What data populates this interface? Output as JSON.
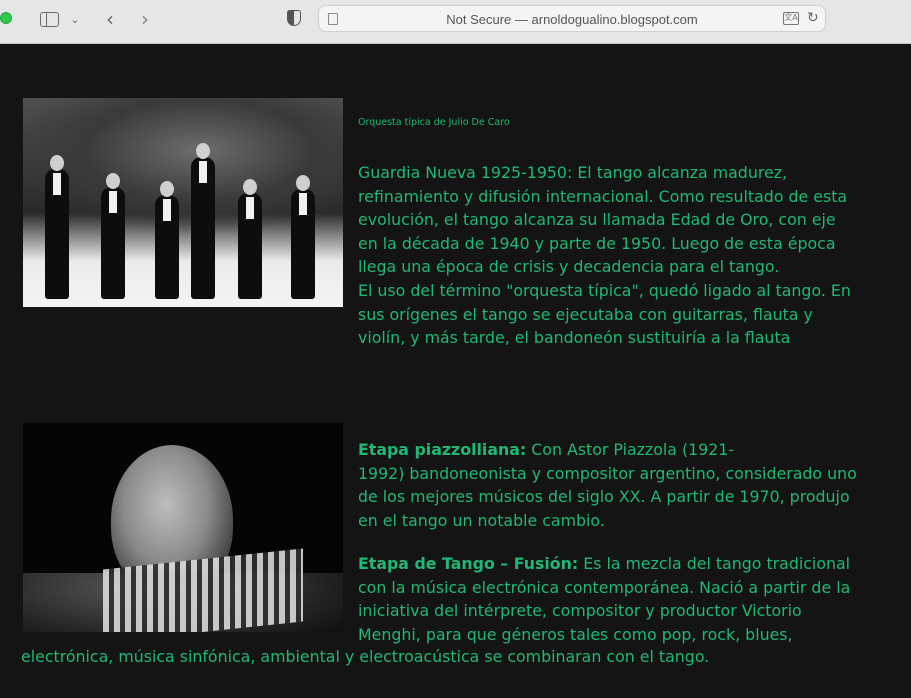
{
  "browser": {
    "url_display": "Not Secure — arnoldogualino.blogspot.com",
    "translate_label": "文A",
    "icons": [
      "sidebar-icon",
      "chevron-down-icon",
      "back-icon",
      "forward-icon",
      "shield-icon",
      "page-icon",
      "translate-icon",
      "reload-icon"
    ]
  },
  "section1": {
    "image_caption": "Orquesta típica de Julio De Caro",
    "lines": [
      "Guardia Nueva 1925-1950: El tango alcanza madurez,",
      "refinamiento y difusión internacional. Como resultado de esta",
      "evolución, el tango alcanza su llamada Edad de Oro, con eje",
      "en la década de 1940 y parte de 1950. Luego de esta época",
      "llega una época de crisis y decadencia para el tango.",
      "El uso del término \"orquesta típica\", quedó ligado al tango. En",
      "sus orígenes el tango se ejecutaba con guitarras, flauta y",
      "violín, y más tarde, el bandoneón sustituiría a la flauta"
    ]
  },
  "section2": {
    "heading1": "Etapa piazzolliana:",
    "line1_rest": " Con Astor Piazzola (1921-",
    "lines1": [
      "1992) bandoneonista y compositor argentino, considerado uno",
      "de los mejores músicos del siglo XX. A partir de 1970, produjo",
      "en el tango un notable cambio."
    ],
    "heading2": "Etapa de Tango – Fusión:",
    "line2_rest": " Es la mezcla del tango tradicional",
    "lines2": [
      "con la música electrónica contemporánea. Nació a partir de la",
      "iniciativa del intérprete, compositor y productor Victorio",
      "Menghi, para que géneros tales como pop, rock, blues,"
    ],
    "last_line": "electrónica, música sinfónica, ambiental y electroacústica se combinaran con el tango."
  },
  "colors": {
    "text": "#1fb874",
    "background": "#141414"
  }
}
